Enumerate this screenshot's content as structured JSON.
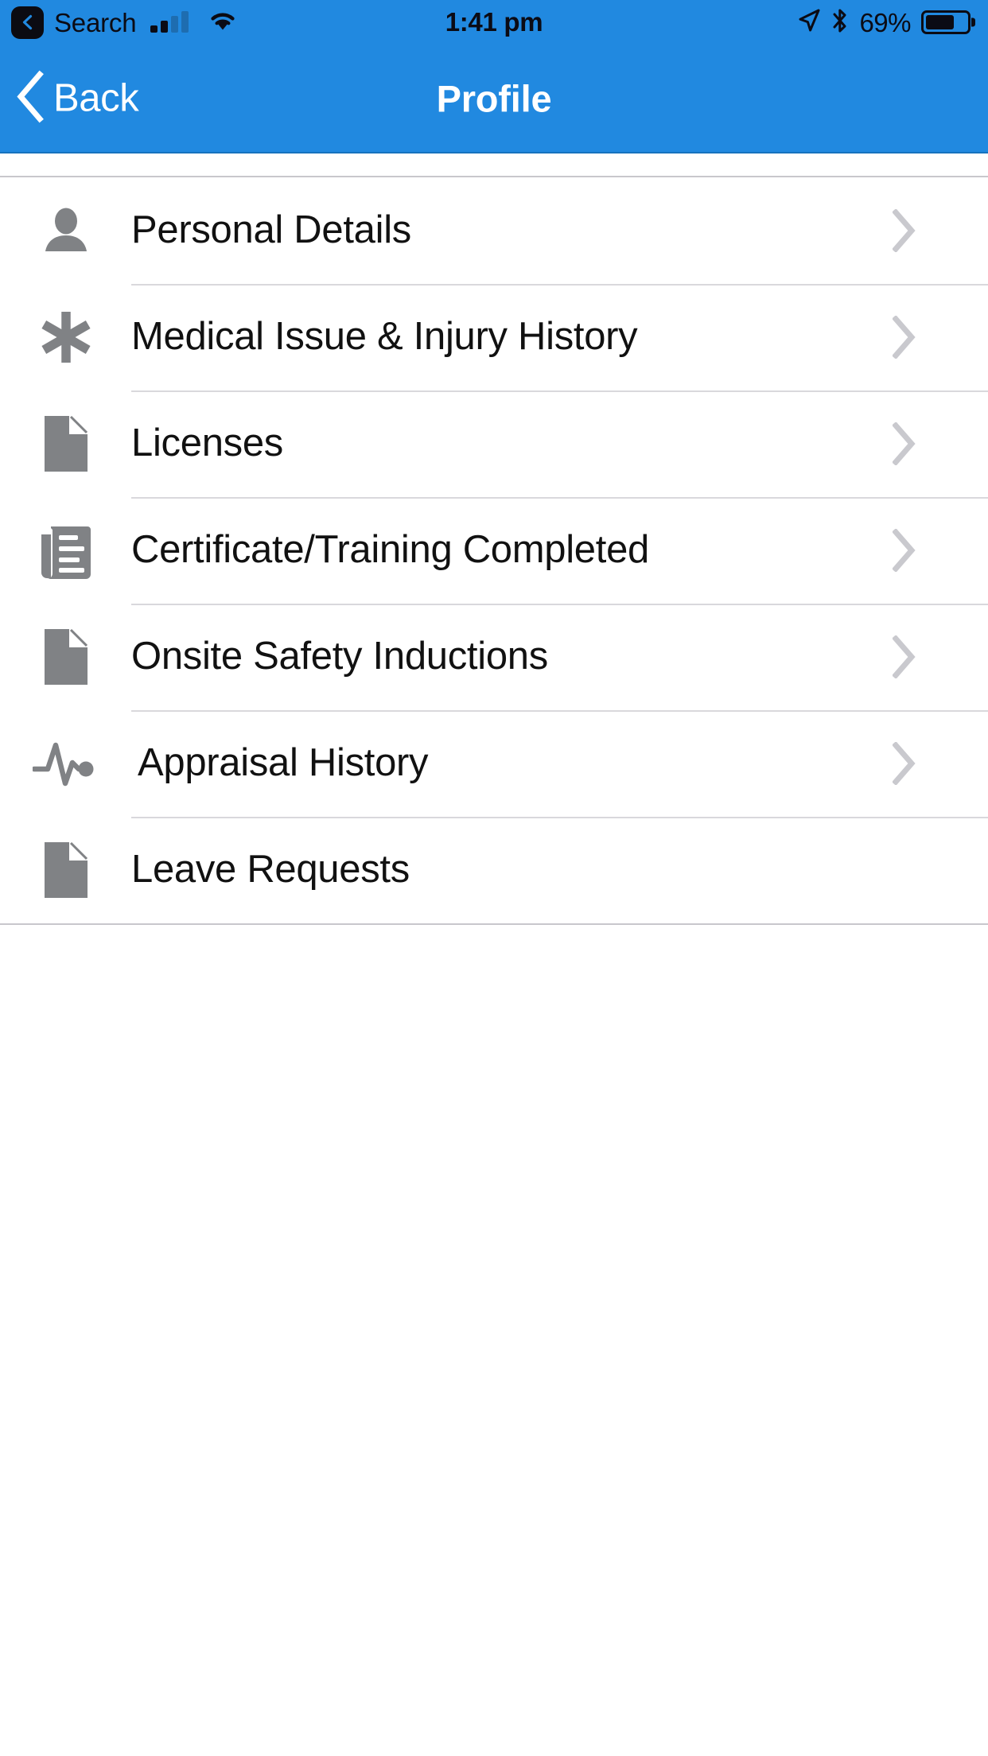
{
  "status_bar": {
    "back_app_label": "Search",
    "back_app_icon": "chevron-left-badge-icon",
    "signal_icon": "cellular-signal-icon",
    "wifi_icon": "wifi-icon",
    "time": "1:41 pm",
    "location_icon": "location-arrow-icon",
    "bluetooth_icon": "bluetooth-icon",
    "battery_percent": "69%",
    "battery_level": 69,
    "tint_color": "#2189E0",
    "foreground_color": "#0B0B14"
  },
  "nav_bar": {
    "back_label": "Back",
    "back_icon": "chevron-left-icon",
    "title": "Profile",
    "background_color": "#2189E0",
    "text_color": "#FFFFFF"
  },
  "list": {
    "separator_color": "#D9D8DC",
    "icon_color": "#808285",
    "chevron_color": "#C9C9CE",
    "items": [
      {
        "label": "Personal Details",
        "icon": "person-icon",
        "has_chevron": true
      },
      {
        "label": "Medical Issue & Injury History",
        "icon": "asterisk-medical-icon",
        "has_chevron": true
      },
      {
        "label": "Licenses",
        "icon": "document-icon",
        "has_chevron": true
      },
      {
        "label": "Certificate/Training Completed",
        "icon": "certificate-lines-icon",
        "has_chevron": true
      },
      {
        "label": "Onsite Safety Inductions",
        "icon": "document-icon",
        "has_chevron": true
      },
      {
        "label": "Appraisal History",
        "icon": "pulse-activity-icon",
        "has_chevron": true
      },
      {
        "label": "Leave Requests",
        "icon": "document-icon",
        "has_chevron": false
      }
    ]
  }
}
